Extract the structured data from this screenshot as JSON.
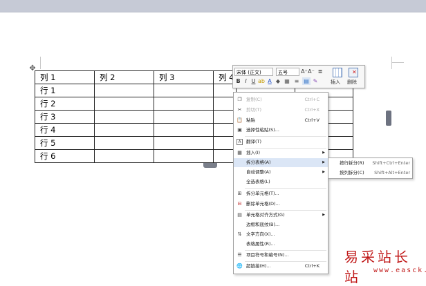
{
  "table": {
    "header": [
      "列 1",
      "列 2",
      "列 3",
      "列 4",
      "",
      ""
    ],
    "rows": [
      "行 1",
      "行 2",
      "行 3",
      "行 4",
      "行 5",
      "行 6"
    ]
  },
  "mini_toolbar": {
    "font_name": "宋体 (正文)",
    "font_size": "五号",
    "grow_font": "A⁺",
    "shrink_font": "A⁻",
    "bold": "B",
    "italic": "I",
    "underline": "U",
    "insert_label": "插入",
    "delete_label": "删除"
  },
  "context_menu": {
    "items": [
      {
        "label": "复制(C)",
        "shortcut": "Ctrl+C",
        "icon": "copy-icon",
        "disabled": true
      },
      {
        "label": "剪切(T)",
        "shortcut": "Ctrl+X",
        "icon": "cut-icon",
        "disabled": true
      },
      {
        "label": "粘贴",
        "shortcut": "Ctrl+V",
        "icon": "paste-icon"
      },
      {
        "label": "选择性粘贴(S)...",
        "shortcut": "",
        "icon": "paste-special-icon"
      },
      {
        "label": "翻译(T)",
        "shortcut": "",
        "icon": "translate-icon"
      },
      {
        "label": "插入(I)",
        "shortcut": "",
        "icon": "insert-table-icon"
      },
      {
        "label": "拆分表格(A)",
        "shortcut": "",
        "icon": "",
        "highlighted": true
      },
      {
        "label": "自动调整(A)",
        "shortcut": "",
        "icon": ""
      },
      {
        "label": "全选表格(L)",
        "shortcut": "",
        "icon": ""
      },
      {
        "label": "拆分单元格(T)...",
        "shortcut": "",
        "icon": "split-cell-icon"
      },
      {
        "label": "删除单元格(D)...",
        "shortcut": "",
        "icon": "delete-cell-icon"
      },
      {
        "label": "单元格对齐方式(G)",
        "shortcut": "",
        "icon": "align-cell-icon"
      },
      {
        "label": "边框和底纹(B)...",
        "shortcut": "",
        "icon": ""
      },
      {
        "label": "文字方向(X)...",
        "shortcut": "",
        "icon": "text-direction-icon"
      },
      {
        "label": "表格属性(R)...",
        "shortcut": "",
        "icon": ""
      },
      {
        "label": "项目符号和编号(N)...",
        "shortcut": "",
        "icon": "bullets-icon"
      },
      {
        "label": "超链接(H)...",
        "shortcut": "Ctrl+K",
        "icon": "hyperlink-icon"
      }
    ]
  },
  "submenu": {
    "items": [
      {
        "label": "按行拆分(R)",
        "shortcut": "Shift+Ctrl+Enter"
      },
      {
        "label": "按列拆分(C)",
        "shortcut": "Shift+Alt+Enter"
      }
    ]
  },
  "watermark": {
    "title": "易采站长站",
    "url": "www.easck.com"
  },
  "colors": {
    "highlight": "#dbe6f6",
    "watermark": "#c01818",
    "font_color_accent": "#1f4fc8",
    "highlight_color_accent": "#ffd800"
  }
}
